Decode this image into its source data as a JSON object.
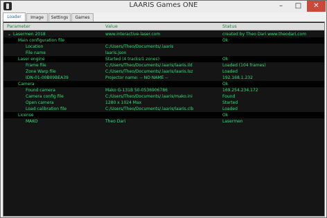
{
  "window": {
    "title": "LAARIS Games ONE",
    "min": "–",
    "max": "□",
    "close": "✕"
  },
  "tabs": [
    "Loader",
    "Image",
    "Settings",
    "Games"
  ],
  "table": {
    "headers": {
      "parameter": "Parameter",
      "value": "Value",
      "status": "Status"
    },
    "rows": [
      {
        "parameter": "Lasermen 2018",
        "value": "www.interactive-laser.com",
        "status": "created by Theo Dari www.theodari.com",
        "section": false,
        "chevron": "⌄"
      },
      {
        "parameter": "Main configuration file",
        "value": "",
        "status": "Ok",
        "section": true,
        "chevron": ""
      },
      {
        "parameter": "Location",
        "value": "C:/Users/Theo/Documents/.laaris",
        "status": "",
        "section": false,
        "chevron": ""
      },
      {
        "parameter": "File name",
        "value": "laaris.json",
        "status": "",
        "section": false,
        "chevron": ""
      },
      {
        "parameter": "Laser engine",
        "value": "Started  (4 tracks/1 zones)",
        "status": "Ok",
        "section": true,
        "chevron": ""
      },
      {
        "parameter": "Frame file",
        "value": "C:/Users/Theo/Documents/.laaris/laaris.ild",
        "status": "Loaded  (104 frames)",
        "section": false,
        "chevron": ""
      },
      {
        "parameter": "Zone Warp file",
        "value": "C:/Users/Theo/Documents/.laaris/laaris.lsz",
        "status": "Loaded",
        "section": false,
        "chevron": ""
      },
      {
        "parameter": "IDN-01-00B09BEA39",
        "value": "Projector name:    -- NO NAME --",
        "status": "192.168.1.232",
        "section": false,
        "chevron": ""
      },
      {
        "parameter": "Camera",
        "value": "",
        "status": "Ok",
        "section": true,
        "chevron": ""
      },
      {
        "parameter": "Found camera",
        "value": "Mako G-131B 50-0536906786",
        "status": "169.254.234.172",
        "section": false,
        "chevron": ""
      },
      {
        "parameter": "Camera config file",
        "value": "C:/Users/Theo/Documents/.laaris/mako.ini",
        "status": "Found",
        "section": false,
        "chevron": ""
      },
      {
        "parameter": "Open camera",
        "value": "1280 x 1024 Max",
        "status": "Started",
        "section": false,
        "chevron": ""
      },
      {
        "parameter": "Load calibration file",
        "value": "C:/Users/Theo/Documents/.laaris/laaris.clb",
        "status": "Loaded",
        "section": false,
        "chevron": ""
      },
      {
        "parameter": "License",
        "value": "",
        "status": "Ok",
        "section": true,
        "chevron": ""
      },
      {
        "parameter": "MAKO",
        "value": "Theo Dari",
        "status": "Lasermen",
        "section": false,
        "chevron": ""
      }
    ]
  }
}
